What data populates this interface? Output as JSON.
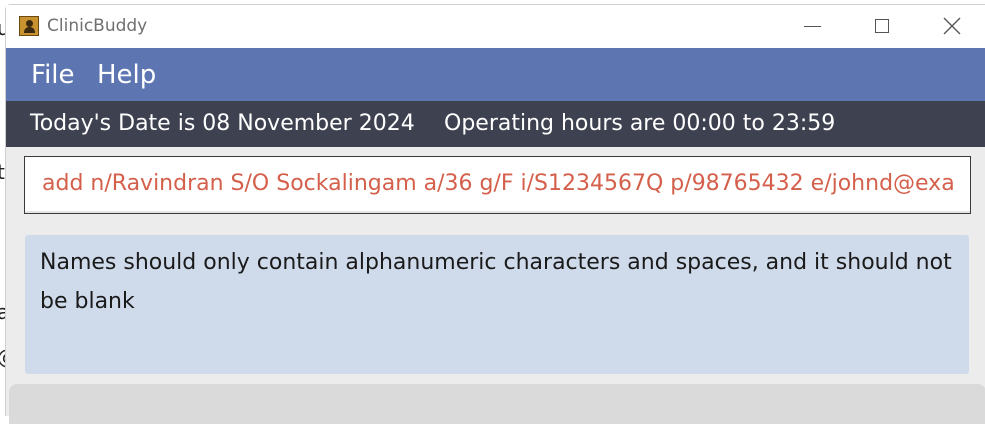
{
  "window": {
    "title": "ClinicBuddy",
    "icon": "clinicbuddy-app-icon"
  },
  "menu": {
    "items": [
      {
        "label": "File"
      },
      {
        "label": "Help"
      }
    ]
  },
  "status": {
    "date_text": "Today's Date is 08 November 2024",
    "hours_text": "Operating hours are 00:00 to 23:59"
  },
  "command": {
    "value": "add n/Ravindran S/O Sockalingam a/36 g/F i/S1234567Q p/98765432 e/johnd@exa"
  },
  "result": {
    "message": "Names should only contain alphanumeric characters and spaces, and it should not be blank"
  },
  "colors": {
    "menubar": "#5d76b2",
    "statusbar": "#3d4150",
    "command_text": "#d4604c",
    "result_bg": "#cfdbeb"
  }
}
